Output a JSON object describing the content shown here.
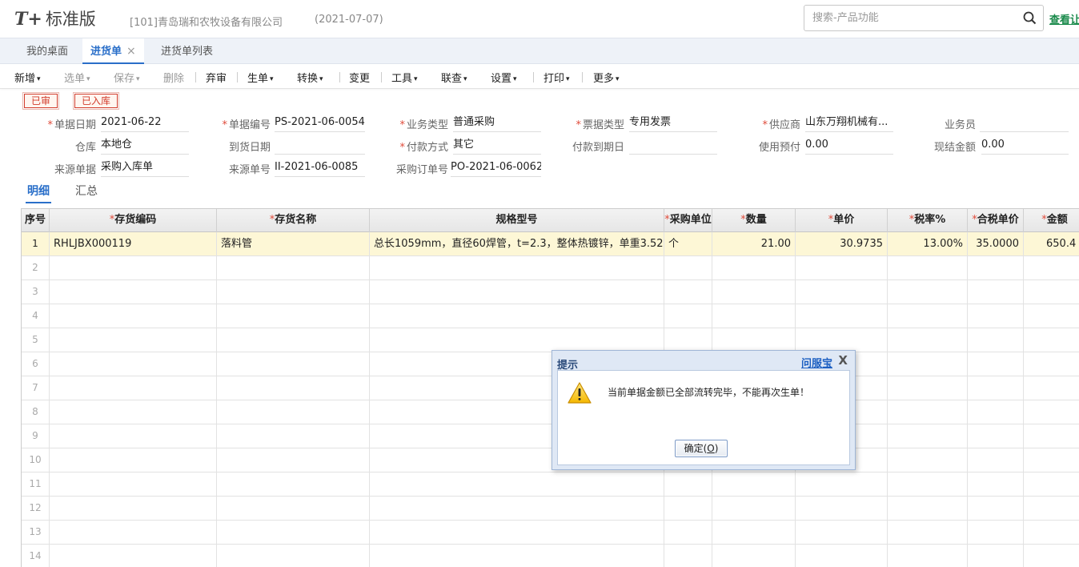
{
  "header": {
    "logo_mark": "T+",
    "logo_text": "标准版",
    "company": "[101]青岛瑞和农牧设备有限公司",
    "date": "(2021-07-07)",
    "search_placeholder": "搜索-产品功能",
    "view_link": "查看让"
  },
  "tabs": [
    {
      "label": "我的桌面"
    },
    {
      "label": "进货单",
      "close": "×"
    },
    {
      "label": "进货单列表"
    }
  ],
  "toolbar": [
    {
      "label": "新增",
      "caret": "▾"
    },
    {
      "label": "选单",
      "caret": "▾"
    },
    {
      "label": "保存",
      "caret": "▾"
    },
    {
      "label": "删除"
    },
    {
      "label": "弃审"
    },
    {
      "label": "生单",
      "caret": "▾"
    },
    {
      "label": "转换",
      "caret": "▾"
    },
    {
      "label": "变更"
    },
    {
      "label": "工具",
      "caret": "▾"
    },
    {
      "label": "联查",
      "caret": "▾"
    },
    {
      "label": "设置",
      "caret": "▾"
    },
    {
      "label": "打印",
      "caret": "▾"
    },
    {
      "label": "更多",
      "caret": "▾"
    }
  ],
  "badges": [
    "已审",
    "已入库"
  ],
  "form": {
    "date_label": "单据日期",
    "date_value": "2021-06-22",
    "code_label": "单据编号",
    "code_value": "PS-2021-06-0054",
    "biztype_label": "业务类型",
    "biztype_value": "普通采购",
    "invoice_label": "票据类型",
    "invoice_value": "专用发票",
    "supplier_label": "供应商",
    "supplier_value": "山东万翔机械有...",
    "staff_label": "业务员",
    "staff_value": "",
    "warehouse_label": "仓库",
    "warehouse_value": "本地仓",
    "arrival_label": "到货日期",
    "arrival_value": "",
    "payment_label": "付款方式",
    "payment_value": "其它",
    "due_label": "付款到期日",
    "due_value": "",
    "prepay_label": "使用预付",
    "prepay_value": "0.00",
    "cash_label": "现结金额",
    "cash_value": "0.00",
    "source_label": "来源单据",
    "source_value": "采购入库单",
    "source_no_label": "来源单号",
    "source_no_value": "II-2021-06-0085",
    "po_label": "采购订单号",
    "po_value": "PO-2021-06-0062"
  },
  "subtabs": [
    "明细",
    "汇总"
  ],
  "grid": {
    "headers": [
      "序号",
      "存货编码",
      "存货名称",
      "规格型号",
      "采购单位",
      "数量",
      "单价",
      "税率%",
      "合税单价",
      "金额"
    ],
    "required_mark": "*",
    "row": {
      "idx": "1",
      "code": "RHLJBX000119",
      "name": "落料管",
      "spec": "总长1059mm，直径60焊管，t=2.3，整体热镀锌，单重3.52...",
      "unit": "个",
      "qty": "21.00",
      "price": "30.9735",
      "tax_rate": "13.00%",
      "tax_price": "35.0000",
      "amount": "650.4"
    },
    "empty_rows": [
      "2",
      "3",
      "4",
      "5",
      "6",
      "7",
      "8",
      "9",
      "10",
      "11",
      "12",
      "13",
      "14"
    ]
  },
  "dialog": {
    "title": "提示",
    "help": "问服宝",
    "close": "X",
    "message": "当前单据金额已全部流转完毕，不能再次生单！",
    "ok_text": "确定(",
    "ok_key": "O",
    "ok_end": ")"
  }
}
